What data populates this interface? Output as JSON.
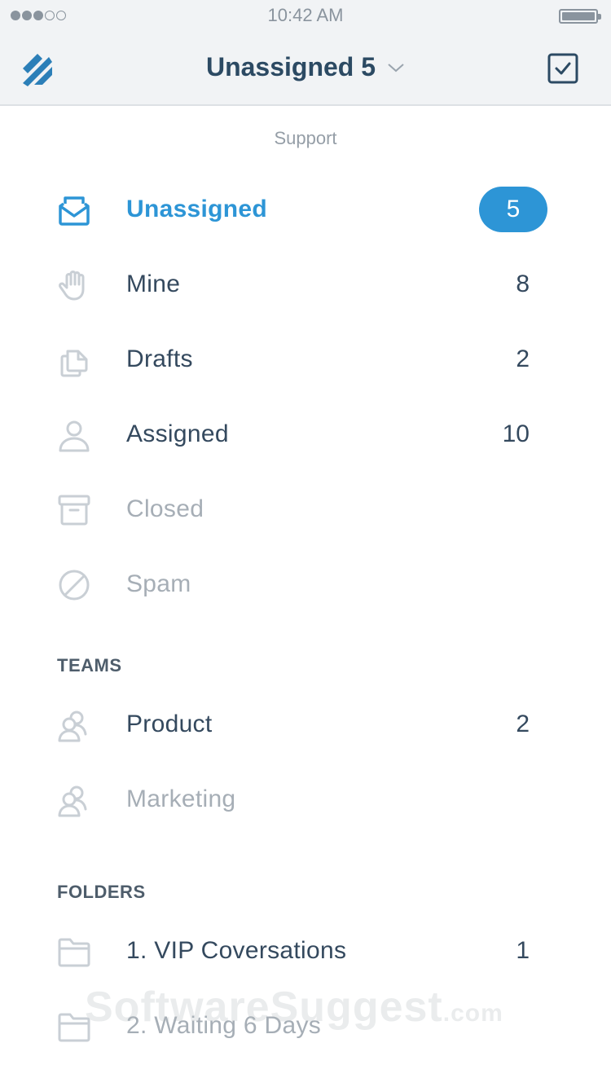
{
  "status_bar": {
    "time": "10:42 AM"
  },
  "nav": {
    "title": "Unassigned 5"
  },
  "mailbox": {
    "caption": "Support"
  },
  "inbox_items": [
    {
      "label": "Unassigned",
      "count": "5",
      "icon": "envelope-open-icon"
    },
    {
      "label": "Mine",
      "count": "8",
      "icon": "hand-icon"
    },
    {
      "label": "Drafts",
      "count": "2",
      "icon": "drafts-icon"
    },
    {
      "label": "Assigned",
      "count": "10",
      "icon": "user-icon"
    },
    {
      "label": "Closed",
      "count": "",
      "icon": "archive-icon"
    },
    {
      "label": "Spam",
      "count": "",
      "icon": "block-icon"
    }
  ],
  "teams": {
    "heading": "TEAMS",
    "items": [
      {
        "label": "Product",
        "count": "2",
        "icon": "team-icon"
      },
      {
        "label": "Marketing",
        "count": "",
        "icon": "team-icon"
      }
    ]
  },
  "folders": {
    "heading": "FOLDERS",
    "items": [
      {
        "label": "1. VIP Coversations",
        "count": "1",
        "icon": "folder-icon"
      },
      {
        "label": "2. Waiting 6 Days",
        "count": "",
        "icon": "folder-icon"
      }
    ]
  },
  "watermark": {
    "main": "SoftwareSuggest",
    "suffix": ".com"
  },
  "colors": {
    "accent": "#2d95d6",
    "nav_title": "#2c4a63",
    "text": "#34495e",
    "muted": "#a6aeb6",
    "icon": "#c9cfd5"
  }
}
